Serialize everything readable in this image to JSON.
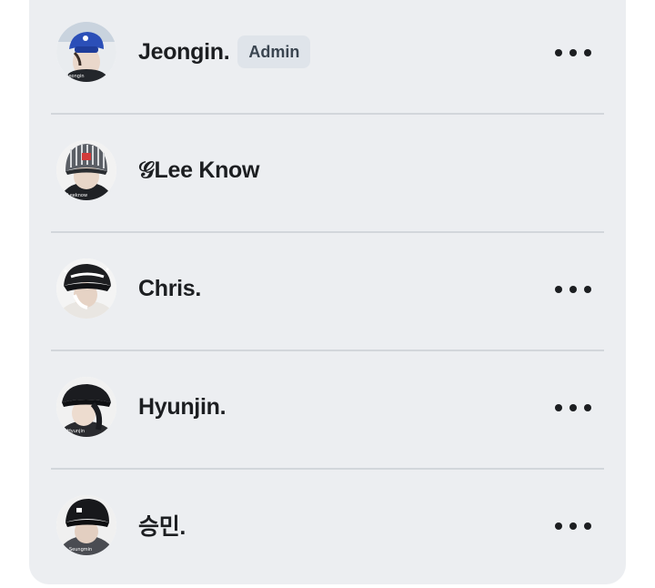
{
  "members": [
    {
      "name": "Jeongin.",
      "badge": "Admin",
      "has_menu": true,
      "avatar_icon": "profile-photo-blue-cap"
    },
    {
      "name": "𝒢Lee Know",
      "badge": "",
      "has_menu": false,
      "avatar_icon": "profile-photo-striped-cap"
    },
    {
      "name": "Chris.",
      "badge": "",
      "has_menu": true,
      "avatar_icon": "profile-photo-black-cap"
    },
    {
      "name": "Hyunjin.",
      "badge": "",
      "has_menu": true,
      "avatar_icon": "profile-photo-black-cap"
    },
    {
      "name": "승민.",
      "badge": "",
      "has_menu": true,
      "avatar_icon": "profile-photo-black-cap"
    }
  ],
  "more_icon": "more-horizontal-icon",
  "colors": {
    "panel_bg": "#eceef1",
    "divider": "#d2d6db",
    "badge_bg": "#dfe4ea",
    "text": "#1c1e21"
  }
}
